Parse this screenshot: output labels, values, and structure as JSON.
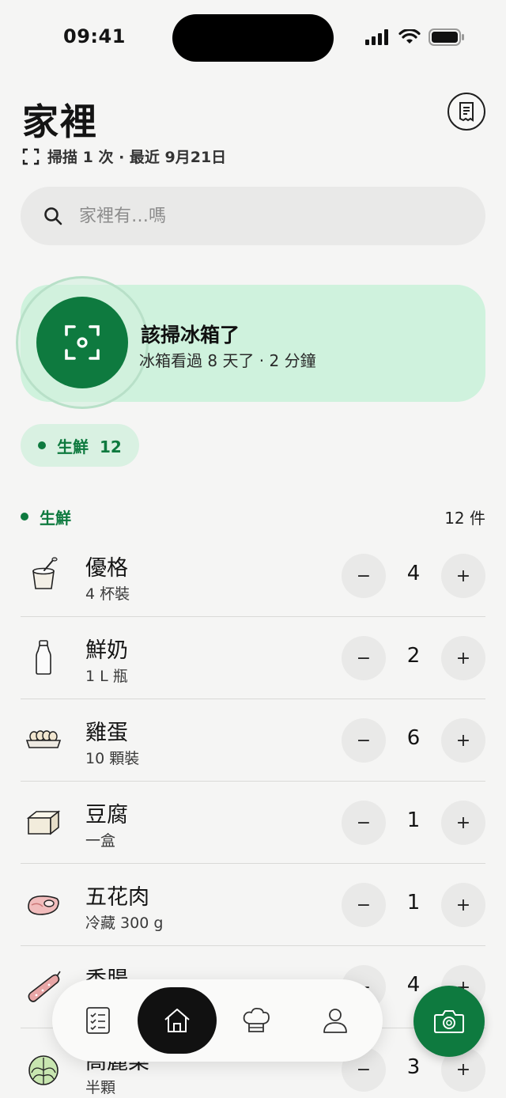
{
  "status_bar": {
    "time": "09:41"
  },
  "header": {
    "title": "家裡",
    "subtitle": "掃描 1 次 · 最近 9月21日"
  },
  "search": {
    "placeholder": "家裡有…嗎"
  },
  "scan_card": {
    "title": "該掃冰箱了",
    "subtitle": "冰箱看過 8 天了 · 2 分鐘"
  },
  "filter_chip": {
    "label": "生鮮",
    "count": "12"
  },
  "section": {
    "title": "生鮮",
    "count": "12 件"
  },
  "items": [
    {
      "name": "優格",
      "desc": "4 杯裝",
      "qty": "4",
      "icon": "yogurt-icon"
    },
    {
      "name": "鮮奶",
      "desc": "1 L 瓶",
      "qty": "2",
      "icon": "milk-bottle-icon"
    },
    {
      "name": "雞蛋",
      "desc": "10 顆裝",
      "qty": "6",
      "icon": "egg-carton-icon"
    },
    {
      "name": "豆腐",
      "desc": "一盒",
      "qty": "1",
      "icon": "tofu-icon"
    },
    {
      "name": "五花肉",
      "desc": "冷藏 300 g",
      "qty": "1",
      "icon": "meat-icon"
    },
    {
      "name": "香腸",
      "desc": "",
      "qty": "4",
      "icon": "sausage-icon"
    },
    {
      "name": "高麗菜",
      "desc": "半顆",
      "qty": "3",
      "icon": "cabbage-icon"
    }
  ],
  "stepper": {
    "minus": "−",
    "plus": "+"
  },
  "tabs": [
    "checklist-icon",
    "home-icon",
    "chef-hat-icon",
    "profile-icon"
  ],
  "colors": {
    "accent": "#0e7a3f",
    "card": "#cff2dd",
    "background": "#f5f5f4"
  }
}
